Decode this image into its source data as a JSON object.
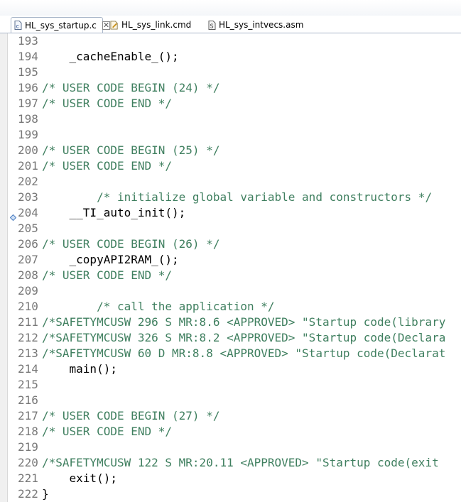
{
  "tabs": [
    {
      "label": "HL_sys_startup.c",
      "active": true,
      "icon": "c-file-icon",
      "close": "✕"
    },
    {
      "label": "HL_sys_link.cmd",
      "active": false,
      "icon": "cmd-file-icon"
    },
    {
      "label": "HL_sys_intvecs.asm",
      "active": false,
      "icon": "asm-file-icon"
    }
  ],
  "colors": {
    "comment": "#3f7f5f",
    "line_number": "#787878",
    "code": "#000000",
    "breakpoint": "#4a7cc0"
  },
  "lines": [
    {
      "num": "193",
      "text": "",
      "comment": false
    },
    {
      "num": "194",
      "text": "    _cacheEnable_();",
      "comment": false
    },
    {
      "num": "195",
      "text": "",
      "comment": false
    },
    {
      "num": "196",
      "text": "/* USER CODE BEGIN (24) */",
      "comment": true
    },
    {
      "num": "197",
      "text": "/* USER CODE END */",
      "comment": true
    },
    {
      "num": "198",
      "text": "",
      "comment": false
    },
    {
      "num": "199",
      "text": "",
      "comment": false
    },
    {
      "num": "200",
      "text": "/* USER CODE BEGIN (25) */",
      "comment": true
    },
    {
      "num": "201",
      "text": "/* USER CODE END */",
      "comment": true
    },
    {
      "num": "202",
      "text": "",
      "comment": false
    },
    {
      "num": "203",
      "text": "        /* initialize global variable and constructors */",
      "comment": true
    },
    {
      "num": "204",
      "text": "    __TI_auto_init();",
      "comment": false,
      "marker": true
    },
    {
      "num": "205",
      "text": "",
      "comment": false
    },
    {
      "num": "206",
      "text": "/* USER CODE BEGIN (26) */",
      "comment": true
    },
    {
      "num": "207",
      "text": "    _copyAPI2RAM_();",
      "comment": false
    },
    {
      "num": "208",
      "text": "/* USER CODE END */",
      "comment": true
    },
    {
      "num": "209",
      "text": "",
      "comment": false
    },
    {
      "num": "210",
      "text": "        /* call the application */",
      "comment": true
    },
    {
      "num": "211",
      "text": "/*SAFETYMCUSW 296 S MR:8.6 <APPROVED> \"Startup code(library",
      "comment": true
    },
    {
      "num": "212",
      "text": "/*SAFETYMCUSW 326 S MR:8.2 <APPROVED> \"Startup code(Declara",
      "comment": true
    },
    {
      "num": "213",
      "text": "/*SAFETYMCUSW 60 D MR:8.8 <APPROVED> \"Startup code(Declarat",
      "comment": true
    },
    {
      "num": "214",
      "text": "    main();",
      "comment": false
    },
    {
      "num": "215",
      "text": "",
      "comment": false
    },
    {
      "num": "216",
      "text": "",
      "comment": false
    },
    {
      "num": "217",
      "text": "/* USER CODE BEGIN (27) */",
      "comment": true
    },
    {
      "num": "218",
      "text": "/* USER CODE END */",
      "comment": true
    },
    {
      "num": "219",
      "text": "",
      "comment": false
    },
    {
      "num": "220",
      "text": "/*SAFETYMCUSW 122 S MR:20.11 <APPROVED> \"Startup code(exit",
      "comment": true
    },
    {
      "num": "221",
      "text": "    exit();",
      "comment": false
    },
    {
      "num": "222",
      "text": "}",
      "comment": false
    }
  ]
}
